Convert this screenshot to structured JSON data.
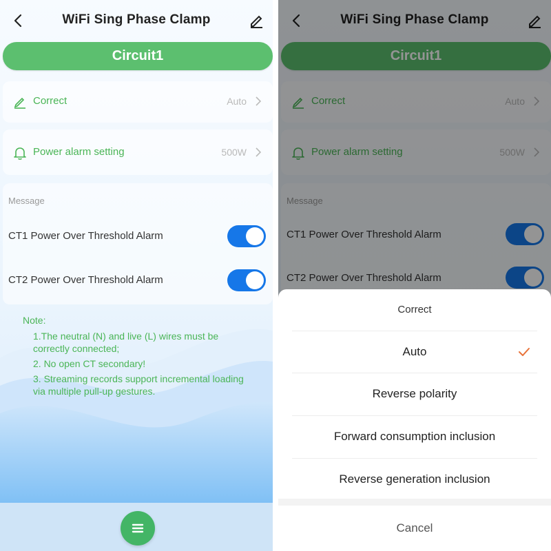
{
  "header": {
    "title": "WiFi Sing Phase Clamp"
  },
  "circuit": {
    "label": "Circuit1"
  },
  "settings": [
    {
      "label": "Correct",
      "value": "Auto",
      "icon": "edit-icon"
    },
    {
      "label": "Power alarm setting",
      "value": "500W",
      "icon": "bell-icon"
    }
  ],
  "message": {
    "section_label": "Message",
    "alarms": [
      {
        "label": "CT1 Power Over Threshold Alarm",
        "enabled": true
      },
      {
        "label": "CT2 Power Over Threshold Alarm",
        "enabled": true
      }
    ]
  },
  "notes": {
    "title": "Note:",
    "items": [
      "1.The neutral (N) and live (L) wires must be correctly connected;",
      "2. No open CT secondary!",
      "3. Streaming records support incremental loading via multiple pull-up gestures."
    ]
  },
  "fab": {
    "icon": "menu-icon"
  },
  "sheet": {
    "title": "Correct",
    "options": [
      "Auto",
      "Reverse polarity",
      "Forward consumption inclusion",
      "Reverse generation inclusion"
    ],
    "selected": "Auto",
    "cancel_label": "Cancel"
  },
  "colors": {
    "accent_green": "#4ab556",
    "circuit_green": "#5cbf6f",
    "toggle_blue": "#1677e8",
    "check_orange": "#e8733a"
  }
}
